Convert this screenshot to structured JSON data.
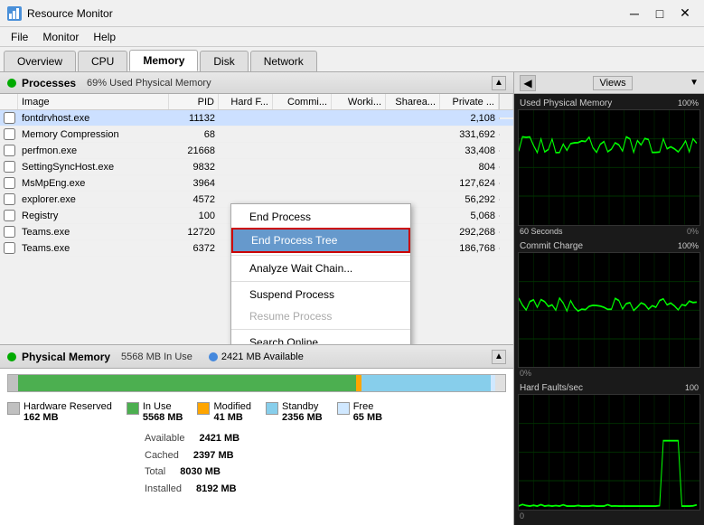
{
  "titleBar": {
    "title": "Resource Monitor",
    "icon": "📊",
    "controls": [
      "─",
      "□",
      "✕"
    ]
  },
  "menuBar": {
    "items": [
      "File",
      "Monitor",
      "Help"
    ]
  },
  "tabs": [
    {
      "label": "Overview",
      "active": false
    },
    {
      "label": "CPU",
      "active": false
    },
    {
      "label": "Memory",
      "active": true
    },
    {
      "label": "Disk",
      "active": false
    },
    {
      "label": "Network",
      "active": false
    }
  ],
  "processSection": {
    "title": "Processes",
    "statusColor": "#00aa00",
    "statusText": "69% Used Physical Memory",
    "columns": [
      "",
      "Image",
      "PID",
      "Hard F...",
      "Commi...",
      "Worki...",
      "Sharea...",
      "Private ...",
      ""
    ],
    "rows": [
      {
        "checked": false,
        "image": "fontdrvhost.exe",
        "pid": "11132",
        "hardf": "",
        "commit": "",
        "working": "",
        "shareable": "",
        "private": "2,108",
        "selected": true
      },
      {
        "checked": false,
        "image": "Memory Compression",
        "pid": "68",
        "hardf": "",
        "commit": "",
        "working": "",
        "shareable": "",
        "private": "331,692"
      },
      {
        "checked": false,
        "image": "perfmon.exe",
        "pid": "21668",
        "hardf": "",
        "commit": "",
        "working": "",
        "shareable": "",
        "private": "33,408"
      },
      {
        "checked": false,
        "image": "SettingSyncHost.exe",
        "pid": "9832",
        "hardf": "",
        "commit": "",
        "working": "",
        "shareable": "",
        "private": "804"
      },
      {
        "checked": false,
        "image": "MsMpEng.exe",
        "pid": "3964",
        "hardf": "",
        "commit": "",
        "working": "",
        "shareable": "",
        "private": "127,624"
      },
      {
        "checked": false,
        "image": "explorer.exe",
        "pid": "4572",
        "hardf": "",
        "commit": "",
        "working": "",
        "shareable": "",
        "private": "56,292"
      },
      {
        "checked": false,
        "image": "Registry",
        "pid": "100",
        "hardf": "",
        "commit": "",
        "working": "",
        "shareable": "",
        "private": "5,068"
      },
      {
        "checked": false,
        "image": "Teams.exe",
        "pid": "12720",
        "hardf": "",
        "commit": "",
        "working": "",
        "shareable": "",
        "private": "292,268"
      },
      {
        "checked": false,
        "image": "Teams.exe",
        "pid": "6372",
        "hardf": "",
        "commit": "",
        "working": "",
        "shareable": "",
        "private": "186,768"
      }
    ]
  },
  "contextMenu": {
    "items": [
      {
        "label": "End Process",
        "type": "normal"
      },
      {
        "label": "End Process Tree",
        "type": "highlighted"
      },
      {
        "label": "separator1",
        "type": "separator"
      },
      {
        "label": "Analyze Wait Chain...",
        "type": "normal"
      },
      {
        "label": "separator2",
        "type": "separator"
      },
      {
        "label": "Suspend Process",
        "type": "normal"
      },
      {
        "label": "Resume Process",
        "type": "disabled"
      },
      {
        "label": "separator3",
        "type": "separator"
      },
      {
        "label": "Search Online",
        "type": "normal"
      }
    ]
  },
  "memorySection": {
    "title": "Physical Memory",
    "statusColor": "#4caf50",
    "statusText": "5568 MB In Use",
    "statusColor2": "#87ceeb",
    "statusText2": "2421 MB Available",
    "barSegments": [
      {
        "label": "Hardware Reserved",
        "sublabel": "162 MB",
        "color": "#c0c0c0",
        "pct": 2
      },
      {
        "label": "In Use",
        "sublabel": "5568 MB",
        "color": "#4caf50",
        "pct": 68
      },
      {
        "label": "Modified",
        "sublabel": "41 MB",
        "color": "#ffa500",
        "pct": 1
      },
      {
        "label": "Standby",
        "sublabel": "2356 MB",
        "color": "#87ceeb",
        "pct": 26
      },
      {
        "label": "Free",
        "sublabel": "65 MB",
        "color": "#d0e8ff",
        "pct": 1
      }
    ],
    "stats": [
      {
        "label": "Available",
        "value": "2421 MB"
      },
      {
        "label": "Cached",
        "value": "2397 MB"
      },
      {
        "label": "Total",
        "value": "8030 MB"
      },
      {
        "label": "Installed",
        "value": "8192 MB"
      }
    ]
  },
  "rightPanel": {
    "viewsLabel": "Views",
    "charts": [
      {
        "label": "Used Physical Memory",
        "pctTop": "100%",
        "pctBottom": "0%"
      },
      {
        "label": "Commit Charge",
        "pctTop": "100%",
        "pctBottom": "0%"
      },
      {
        "label": "Hard Faults/sec",
        "pctTop": "100",
        "pctBottom": "0"
      }
    ],
    "timeLabel": "60 Seconds"
  }
}
